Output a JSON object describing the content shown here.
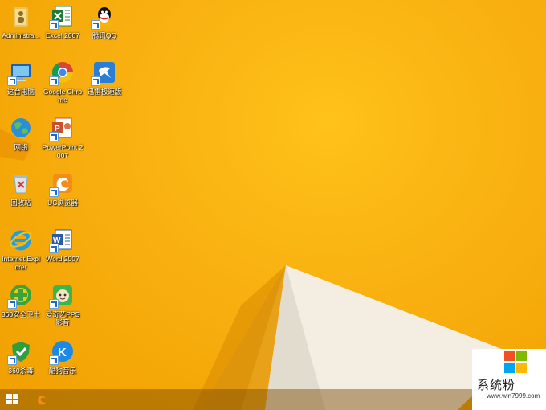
{
  "desktop": {
    "icons": [
      {
        "name": "administrator-folder",
        "label": "Administra..."
      },
      {
        "name": "excel-2007",
        "label": "Excel 2007"
      },
      {
        "name": "tencent-qq",
        "label": "腾讯QQ"
      },
      {
        "name": "this-computer",
        "label": "这台电脑"
      },
      {
        "name": "google-chrome",
        "label": "Google Chrome"
      },
      {
        "name": "xunlei-speed",
        "label": "迅雷极速版"
      },
      {
        "name": "network",
        "label": "网络"
      },
      {
        "name": "powerpoint-2007",
        "label": "PowerPoint 2007"
      },
      {
        "name": "recycle-bin",
        "label": "回收站"
      },
      {
        "name": "uc-browser",
        "label": "UC浏览器"
      },
      {
        "name": "internet-explorer",
        "label": "Internet Explorer"
      },
      {
        "name": "word-2007",
        "label": "Word 2007"
      },
      {
        "name": "360-safe-guard",
        "label": "360安全卫士"
      },
      {
        "name": "iqiyi-pps",
        "label": "爱奇艺PPS 影音"
      },
      {
        "name": "360-antivirus",
        "label": "360杀毒"
      },
      {
        "name": "kugou-music",
        "label": "酷狗音乐"
      }
    ]
  },
  "watermark": {
    "title": "系统粉",
    "url": "www.win7999.com"
  },
  "colors": {
    "wallpaper": "#f8b010",
    "wallpaper_light": "#ffc21a",
    "paper": "#f3ede2",
    "win_red": "#f25022",
    "win_green": "#7fba00",
    "win_blue": "#00a4ef",
    "win_yellow": "#ffb900"
  }
}
